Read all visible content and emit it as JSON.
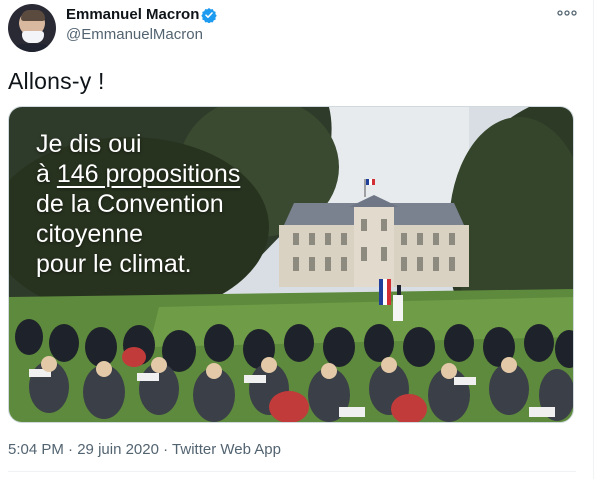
{
  "tweet": {
    "author_name": "Emmanuel Macron",
    "author_handle": "@EmmanuelMacron",
    "text": "Allons-y !",
    "time": "5:04 PM",
    "date": "29 juin 2020",
    "source": "Twitter Web App",
    "meta_separator": " · "
  },
  "image_overlay": {
    "line1": "Je dis oui",
    "line2_prefix": "à ",
    "line2_underlined": "146 propositions",
    "line3": "de la Convention",
    "line4": "citoyenne",
    "line5": "pour le climat."
  },
  "icons": {
    "verified": "verified-badge-icon",
    "more": "more-options-icon"
  },
  "colors": {
    "verified_blue": "#1d9bf0",
    "secondary_text": "#536471",
    "primary_text": "#0f1419"
  }
}
